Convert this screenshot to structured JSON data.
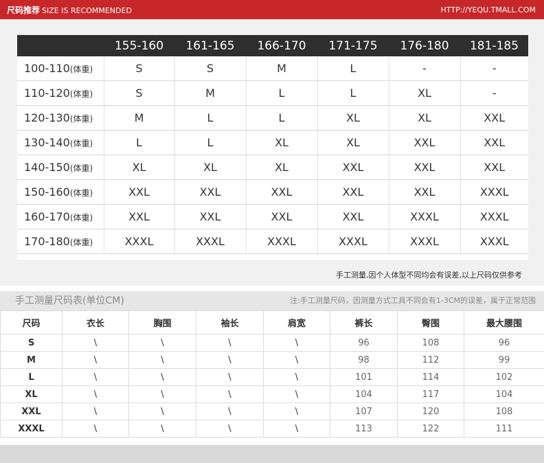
{
  "header": {
    "title": "尺码推荐",
    "subtitle": "SIZE IS RECOMMENDED",
    "url": "HTTP://YEQU.TMALL.COM"
  },
  "size_table": {
    "columns": [
      "155-160",
      "161-165",
      "166-170",
      "171-175",
      "176-180",
      "181-185"
    ],
    "rows": [
      {
        "range": "100-110",
        "unit": "(体重)",
        "cells": [
          "S",
          "S",
          "M",
          "L",
          "-",
          "-"
        ]
      },
      {
        "range": "110-120",
        "unit": "(体重)",
        "cells": [
          "S",
          "M",
          "L",
          "L",
          "XL",
          "-"
        ]
      },
      {
        "range": "120-130",
        "unit": "(体重)",
        "cells": [
          "M",
          "L",
          "L",
          "XL",
          "XL",
          "XXL"
        ]
      },
      {
        "range": "130-140",
        "unit": "(体重)",
        "cells": [
          "L",
          "L",
          "XL",
          "XL",
          "XXL",
          "XXL"
        ]
      },
      {
        "range": "140-150",
        "unit": "(体重)",
        "cells": [
          "XL",
          "XL",
          "XL",
          "XXL",
          "XXL",
          "XXL"
        ]
      },
      {
        "range": "150-160",
        "unit": "(体重)",
        "cells": [
          "XXL",
          "XXL",
          "XXL",
          "XXL",
          "XXL",
          "XXXL"
        ]
      },
      {
        "range": "160-170",
        "unit": "(体重)",
        "cells": [
          "XXL",
          "XXL",
          "XXL",
          "XXL",
          "XXXL",
          "XXXL"
        ]
      },
      {
        "range": "170-180",
        "unit": "(体重)",
        "cells": [
          "XXXL",
          "XXXL",
          "XXXL",
          "XXXL",
          "XXXL",
          "XXXL"
        ]
      }
    ],
    "note": "手工测量,因个人体型不同均会有误差,以上尺码仅供参考"
  },
  "measure_section": {
    "title": "手工测量尺码表(单位CM)",
    "note": "注:手工测量尺码，因测量方式工具不同会有1-3CM的误差，属于正常范围"
  },
  "measure_table": {
    "headers": [
      "尺码",
      "衣长",
      "胸围",
      "袖长",
      "肩宽",
      "裤长",
      "臀围",
      "最大腰围"
    ],
    "rows": [
      [
        "S",
        "\\",
        "\\",
        "\\",
        "\\",
        "96",
        "108",
        "96"
      ],
      [
        "M",
        "\\",
        "\\",
        "\\",
        "\\",
        "98",
        "112",
        "99"
      ],
      [
        "L",
        "\\",
        "\\",
        "\\",
        "\\",
        "101",
        "114",
        "102"
      ],
      [
        "XL",
        "\\",
        "\\",
        "\\",
        "\\",
        "104",
        "117",
        "104"
      ],
      [
        "XXL",
        "\\",
        "\\",
        "\\",
        "\\",
        "107",
        "120",
        "108"
      ],
      [
        "XXXL",
        "\\",
        "\\",
        "\\",
        "\\",
        "113",
        "122",
        "111"
      ]
    ]
  },
  "colors": {
    "header_red": "#c8272a",
    "table_header_dark": "#2e2e2e",
    "section_gray": "#f1f1f1"
  }
}
